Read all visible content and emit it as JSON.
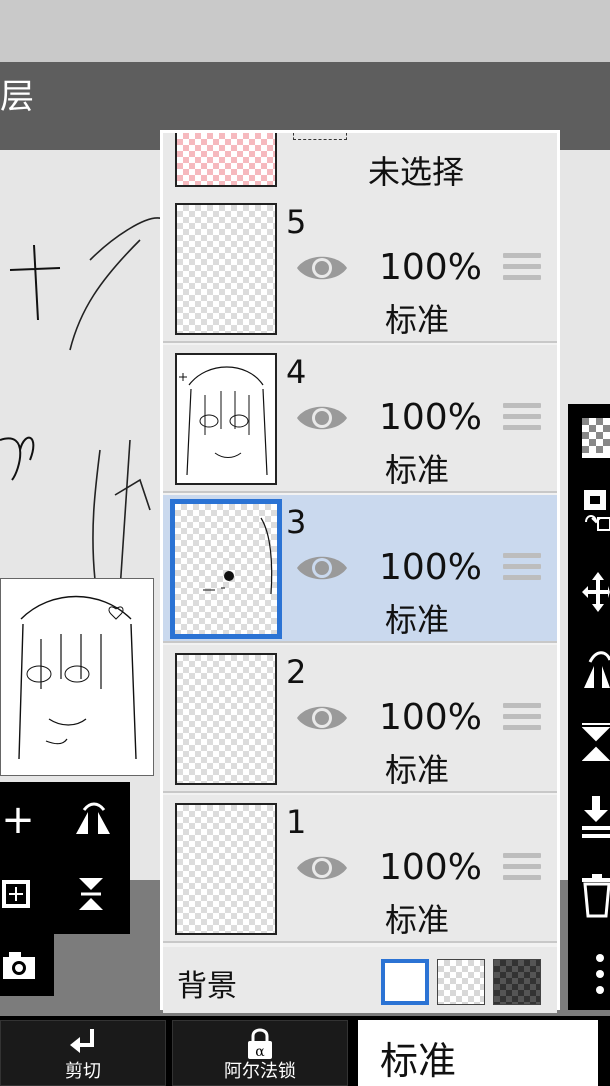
{
  "header": {
    "title_fragment": "层"
  },
  "layers_panel": {
    "partial_row": {
      "label": "未选择"
    },
    "layers": [
      {
        "number": "5",
        "opacity": "100%",
        "mode": "标准",
        "selected": false
      },
      {
        "number": "4",
        "opacity": "100%",
        "mode": "标准",
        "selected": false
      },
      {
        "number": "3",
        "opacity": "100%",
        "mode": "标准",
        "selected": true
      },
      {
        "number": "2",
        "opacity": "100%",
        "mode": "标准",
        "selected": false
      },
      {
        "number": "1",
        "opacity": "100%",
        "mode": "标准",
        "selected": false
      }
    ],
    "background": {
      "label": "背景"
    }
  },
  "bottom_bar": {
    "cut_label": "剪切",
    "alpha_lock_label": "阿尔法锁",
    "blend_mode": "标准"
  },
  "colors": {
    "selected_row": "#cad9ee",
    "selected_border": "#2b73d4",
    "panel_black": "#000000"
  }
}
